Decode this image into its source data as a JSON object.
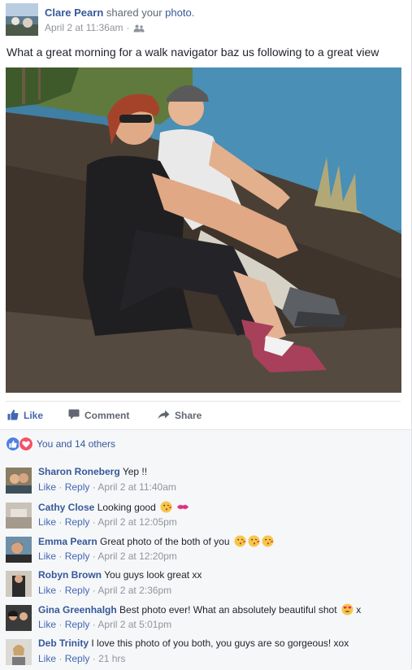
{
  "post": {
    "author": "Clare Pearn",
    "shared_text": "shared your",
    "photo_link": "photo",
    "period": ".",
    "timestamp": "April 2 at 11:36am",
    "dot": "·",
    "audience_icon": "friends-icon",
    "body": "What a great morning for a walk navigator baz us following to a great view"
  },
  "actions": {
    "like": "Like",
    "comment": "Comment",
    "share": "Share"
  },
  "reactions": {
    "summary": "You and 14 others"
  },
  "comments": [
    {
      "name": "Sharon Roneberg",
      "text": "Yep !!",
      "like": "Like",
      "reply": "Reply",
      "time": "April 2 at 11:40am"
    },
    {
      "name": "Cathy Close",
      "text": "Looking good",
      "like": "Like",
      "reply": "Reply",
      "time": "April 2 at 12:05pm"
    },
    {
      "name": "Emma Pearn",
      "text": "Great photo of the both of you",
      "like": "Like",
      "reply": "Reply",
      "time": "April 2 at 12:20pm"
    },
    {
      "name": "Robyn Brown",
      "text": "You guys look great xx",
      "like": "Like",
      "reply": "Reply",
      "time": "April 2 at 2:36pm"
    },
    {
      "name": "Gina Greenhalgh",
      "text": "Best photo ever! What an absolutely beautiful shot",
      "suffix": "x",
      "like": "Like",
      "reply": "Reply",
      "time": "April 2 at 5:01pm"
    },
    {
      "name": "Deb Trinity",
      "text": "I love this photo of you both, you guys are so gorgeous! xox",
      "like": "Like",
      "reply": "Reply",
      "time": "21 hrs"
    }
  ],
  "colors": {
    "link": "#365899",
    "like_active": "#4267b2",
    "meta": "#90949c",
    "comment_bg": "#f6f7f9"
  }
}
